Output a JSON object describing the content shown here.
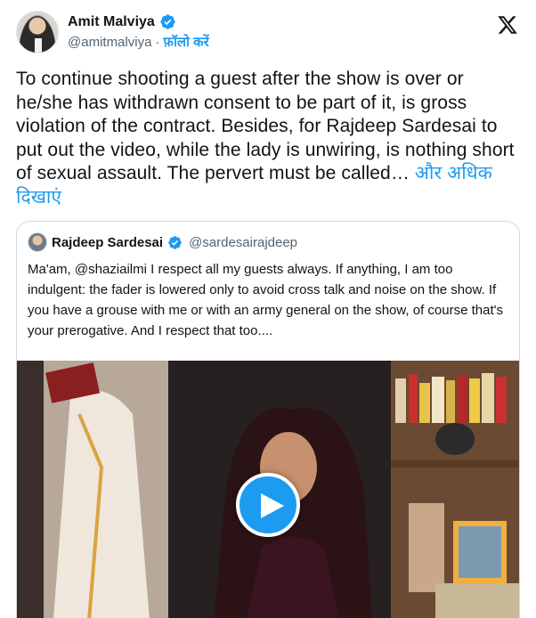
{
  "author": {
    "display_name": "Amit Malviya",
    "handle": "@amitmalviya",
    "separator": "·",
    "follow_label": "फ़ॉलो करें"
  },
  "tweet": {
    "text": "To continue shooting a guest after the show is over or he/she has withdrawn consent to be part of it, is gross violation of the contract. Besides, for Rajdeep Sardesai to put out the video, while the lady is unwiring, is nothing short of sexual assault. The pervert must be called… ",
    "show_more_label": "और अधिक दिखाएं"
  },
  "quoted_tweet": {
    "display_name": "Rajdeep Sardesai",
    "handle": "@sardesairajdeep",
    "text": "Ma'am, @shaziailmi I respect all my guests always. If anything, I am too indulgent: the fader is lowered only to avoid cross talk and noise on the show. If you have a grouse with me or with an army general on the show, of course that's your prerogative. And I respect that too...."
  },
  "media": {
    "type": "video",
    "play_icon": "play-icon"
  },
  "colors": {
    "accent": "#1d9bf0",
    "text_primary": "#0f1419",
    "text_secondary": "#536471",
    "border": "#cfd9de"
  }
}
